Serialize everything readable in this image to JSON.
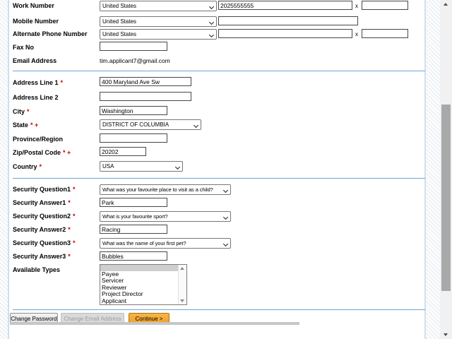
{
  "colors": {
    "divider_blue": "#6ea7d6",
    "required_red": "#cc0000",
    "continue_orange": "#f2a93b",
    "panel_border_blue": "#cfe0ec",
    "scrollbar_thumb": "#a9a9a9",
    "listbox_selected_gray": "#cfcfcf"
  },
  "icons": {
    "select_chevron": "chevron-down",
    "scroll_up": "triangle-up",
    "scroll_down": "triangle-down"
  },
  "contact": {
    "work_number": {
      "label": "Work Number",
      "country": "United States",
      "number": "2025555555",
      "ext_label": "x",
      "ext": ""
    },
    "mobile_number": {
      "label": "Mobile Number",
      "country": "United States",
      "number": ""
    },
    "alternate_number": {
      "label": "Alternate Phone Number",
      "country": "United States",
      "number": "",
      "ext_label": "x",
      "ext": ""
    },
    "fax": {
      "label": "Fax No",
      "value": ""
    },
    "email": {
      "label": "Email Address",
      "value": "tim.applicant7@gmail.com"
    }
  },
  "address": {
    "line1": {
      "label": "Address Line 1",
      "req": "*",
      "value": "400 Maryland Ave Sw"
    },
    "line2": {
      "label": "Address Line 2",
      "value": ""
    },
    "city": {
      "label": "City",
      "req": "*",
      "value": "Washington"
    },
    "state": {
      "label": "State",
      "req": "* +",
      "value": "DISTRICT OF COLUMBIA"
    },
    "province": {
      "label": "Province/Region",
      "value": ""
    },
    "zip": {
      "label": "Zip/Postal Code",
      "req": "* +",
      "value": "20202"
    },
    "country": {
      "label": "Country",
      "req": "*",
      "value": "USA"
    }
  },
  "security": {
    "q1": {
      "label": "Security Question1",
      "req": "*",
      "value": "What was your favourite place to visit as a child?"
    },
    "a1": {
      "label": "Security Answer1",
      "req": "*",
      "value": "Park"
    },
    "q2": {
      "label": "Security Question2",
      "req": "*",
      "value": "What is your favourite sport?"
    },
    "a2": {
      "label": "Security Answer2",
      "req": "*",
      "value": "Racing"
    },
    "q3": {
      "label": "Security Question3",
      "req": "*",
      "value": "What was the name of your first pet?"
    },
    "a3": {
      "label": "Security Answer3",
      "req": "*",
      "value": "Bubbles"
    }
  },
  "available_types": {
    "label": "Available Types",
    "options": [
      "",
      "Payee",
      "Servicer",
      "Reviewer",
      "Project Director",
      "Applicant"
    ],
    "selected_index": 0
  },
  "buttons": {
    "change_password": "Change Password",
    "change_email": "Change Email Address",
    "continue": "Continue >"
  }
}
